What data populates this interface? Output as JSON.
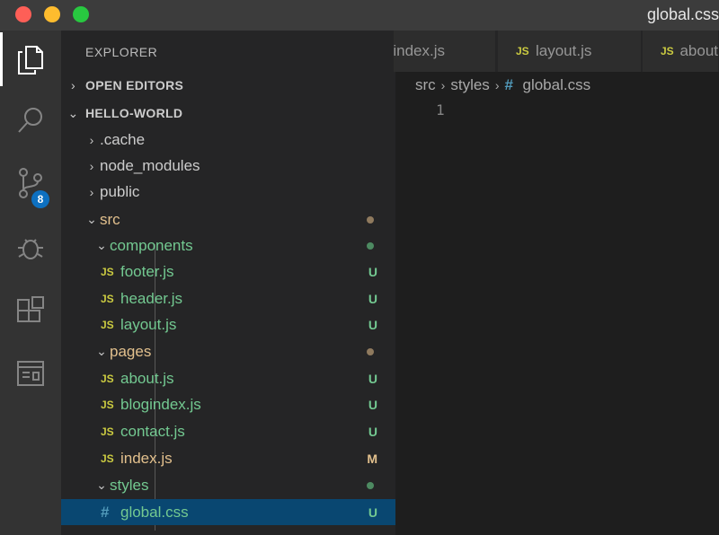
{
  "window": {
    "title": "global.css"
  },
  "activity_bar": {
    "items": [
      {
        "name": "explorer-icon",
        "active": true
      },
      {
        "name": "search-icon",
        "active": false
      },
      {
        "name": "source-control-icon",
        "active": false,
        "badge": "8"
      },
      {
        "name": "debug-icon",
        "active": false
      },
      {
        "name": "extensions-icon",
        "active": false
      },
      {
        "name": "remote-explorer-icon",
        "active": false
      }
    ]
  },
  "sidebar": {
    "title": "EXPLORER",
    "sections": {
      "open_editors": "OPEN EDITORS",
      "project": "HELLO-WORLD"
    },
    "tree": [
      {
        "label": ".cache",
        "type": "folder",
        "status": ""
      },
      {
        "label": "node_modules",
        "type": "folder",
        "status": ""
      },
      {
        "label": "public",
        "type": "folder",
        "status": ""
      },
      {
        "label": "src",
        "type": "folder",
        "status": ""
      },
      {
        "label": "components",
        "type": "folder",
        "status": ""
      },
      {
        "label": "footer.js",
        "type": "js",
        "status": "U"
      },
      {
        "label": "header.js",
        "type": "js",
        "status": "U"
      },
      {
        "label": "layout.js",
        "type": "js",
        "status": "U"
      },
      {
        "label": "pages",
        "type": "folder",
        "status": ""
      },
      {
        "label": "about.js",
        "type": "js",
        "status": "U"
      },
      {
        "label": "blogindex.js",
        "type": "js",
        "status": "U"
      },
      {
        "label": "contact.js",
        "type": "js",
        "status": "U"
      },
      {
        "label": "index.js",
        "type": "js",
        "status": "M"
      },
      {
        "label": "styles",
        "type": "folder",
        "status": ""
      },
      {
        "label": "global.css",
        "type": "css",
        "status": "U"
      }
    ]
  },
  "icons": {
    "js": "JS",
    "css": "#",
    "chevron_right": "›",
    "chevron_down": "⌄"
  },
  "tabs": [
    {
      "label": "index.js"
    },
    {
      "label": "layout.js",
      "icon": "JS"
    },
    {
      "label": "about",
      "icon": "JS"
    }
  ],
  "breadcrumb": {
    "parts": [
      "src",
      "styles",
      "global.css"
    ]
  },
  "editor": {
    "line_numbers": [
      "1"
    ]
  },
  "colors": {
    "accent": "#094771",
    "untracked": "#73c991",
    "modified": "#e2c08d",
    "js_icon": "#cbcb41",
    "css_icon": "#519aba",
    "badge": "#0e70c0"
  }
}
